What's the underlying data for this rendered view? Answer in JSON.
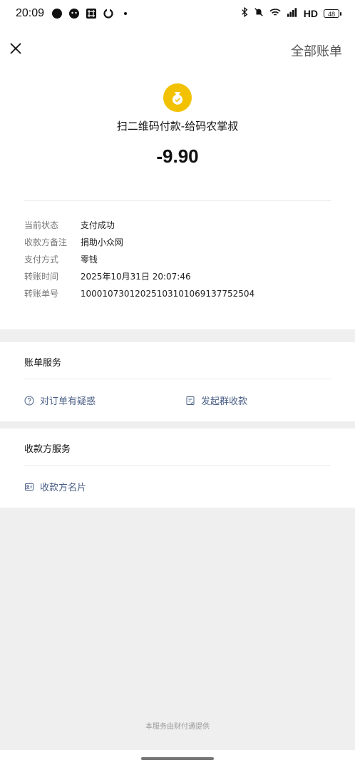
{
  "status_bar": {
    "time": "20:09",
    "network": "HD",
    "battery": "48"
  },
  "header": {
    "close_icon": "close-icon",
    "all_bills": "全部账单"
  },
  "payment": {
    "merchant_name": "扫二维码付款-给码农掌叔",
    "amount": "-9.90",
    "logo_color": "#f2c200",
    "details": [
      {
        "label": "当前状态",
        "value": "支付成功"
      },
      {
        "label": "收款方备注",
        "value": "捐助小众网"
      },
      {
        "label": "支付方式",
        "value": "零钱"
      },
      {
        "label": "转账时间",
        "value": "2025年10月31日 20:07:46"
      },
      {
        "label": "转账单号",
        "value": "10001073012025103101069137752504"
      }
    ]
  },
  "bill_services": {
    "title": "账单服务",
    "items": [
      {
        "label": "对订单有疑惑",
        "icon": "question-icon"
      },
      {
        "label": "发起群收款",
        "icon": "document-icon"
      }
    ]
  },
  "payee_services": {
    "title": "收款方服务",
    "items": [
      {
        "label": "收款方名片",
        "icon": "card-icon"
      }
    ]
  },
  "footer": {
    "text": "本服务由财付通提供"
  },
  "colors": {
    "accent_link": "#4a5f87",
    "background_gray": "#efefef"
  }
}
